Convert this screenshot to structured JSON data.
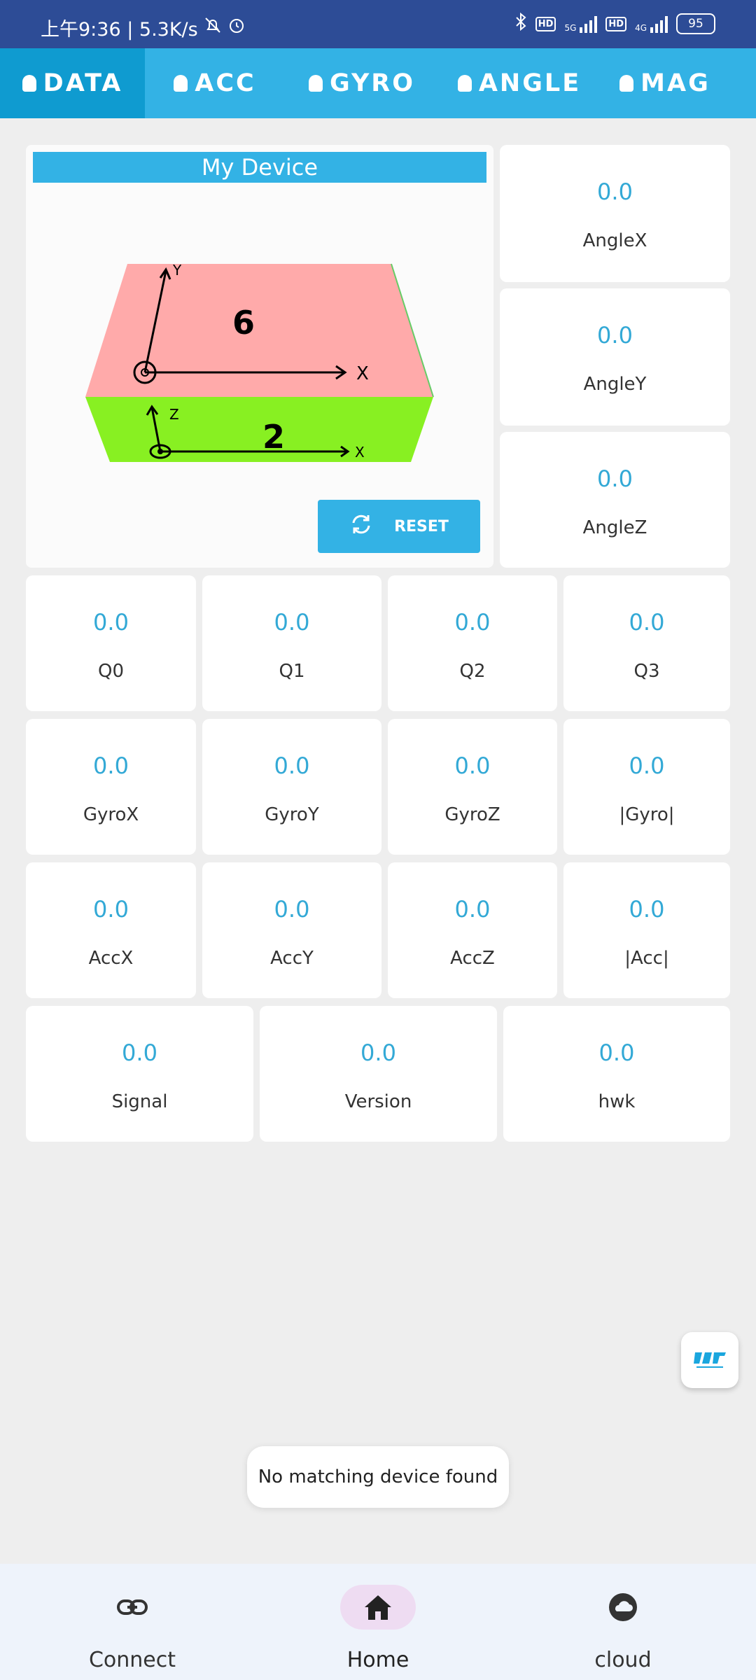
{
  "status": {
    "time": "上午9:36 | 5.3K/s",
    "network_hd": "HD",
    "network_5g": "5G",
    "network_4g": "4G",
    "battery": "95"
  },
  "tabs": [
    {
      "label": "DATA",
      "active": true
    },
    {
      "label": "ACC",
      "active": false
    },
    {
      "label": "GYRO",
      "active": false
    },
    {
      "label": "ANGLE",
      "active": false
    },
    {
      "label": "MAG",
      "active": false
    }
  ],
  "device": {
    "title": "My Device",
    "top_face_number": "6",
    "front_face_number": "2",
    "axis_y": "Y",
    "axis_x_top": "X",
    "axis_z": "Z",
    "axis_x_front": "X",
    "reset_label": "RESET"
  },
  "angle_cards": [
    {
      "value": "0.0",
      "label": "AngleX"
    },
    {
      "value": "0.0",
      "label": "AngleY"
    },
    {
      "value": "0.0",
      "label": "AngleZ"
    }
  ],
  "quat_cards": [
    {
      "value": "0.0",
      "label": "Q0"
    },
    {
      "value": "0.0",
      "label": "Q1"
    },
    {
      "value": "0.0",
      "label": "Q2"
    },
    {
      "value": "0.0",
      "label": "Q3"
    }
  ],
  "gyro_cards": [
    {
      "value": "0.0",
      "label": "GyroX"
    },
    {
      "value": "0.0",
      "label": "GyroY"
    },
    {
      "value": "0.0",
      "label": "GyroZ"
    },
    {
      "value": "0.0",
      "label": "|Gyro|"
    }
  ],
  "acc_cards": [
    {
      "value": "0.0",
      "label": "AccX"
    },
    {
      "value": "0.0",
      "label": "AccY"
    },
    {
      "value": "0.0",
      "label": "AccZ"
    },
    {
      "value": "0.0",
      "label": "|Acc|"
    }
  ],
  "info_cards": [
    {
      "value": "0.0",
      "label": "Signal"
    },
    {
      "value": "0.0",
      "label": "Version"
    },
    {
      "value": "0.0",
      "label": "hwk"
    }
  ],
  "toast": "No matching device found",
  "bottom_nav": [
    {
      "label": "Connect",
      "icon": "link-icon"
    },
    {
      "label": "Home",
      "icon": "home-icon",
      "active": true
    },
    {
      "label": "cloud",
      "icon": "cloud-icon"
    }
  ],
  "colors": {
    "accent": "#33b2e5",
    "value_text": "#33a9d6",
    "top_face": "#ffaaaa",
    "front_face": "#88f022"
  }
}
